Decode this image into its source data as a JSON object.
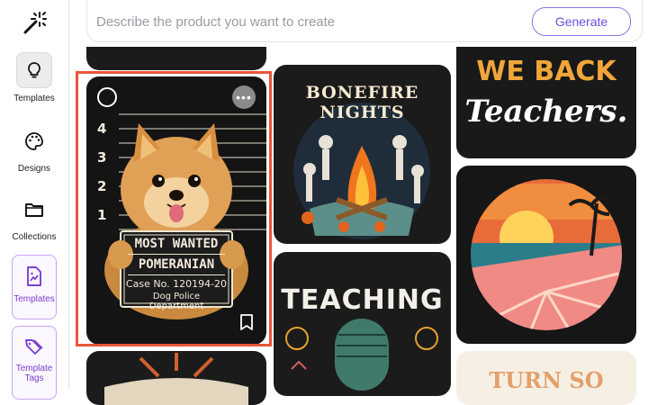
{
  "sidebar": {
    "items": [
      {
        "label": "Templates",
        "icon": "lightbulb-icon"
      },
      {
        "label": "Designs",
        "icon": "palette-icon"
      },
      {
        "label": "Collections",
        "icon": "folder-icon"
      },
      {
        "label": "Templates",
        "icon": "template-doc-icon"
      },
      {
        "label": "Template Tags",
        "icon": "tags-icon"
      }
    ]
  },
  "search": {
    "placeholder": "Describe the product you want to create",
    "generate_label": "Generate"
  },
  "gallery": {
    "poster": {
      "ruler": [
        "4",
        "3",
        "2",
        "1"
      ],
      "title1": "MOST WANTED",
      "title2": "POMERANIAN",
      "case": "Case No. 120194-20",
      "dept": "Dog Police Department"
    },
    "bonfire": {
      "title": "BONEFIRE NIGHTS"
    },
    "teachers": {
      "line1": "WE BACK",
      "line2": "Teachers."
    },
    "teaching": {
      "title": "TEACHING"
    },
    "bottom_partial": {
      "title": "TURN SO"
    }
  },
  "colors": {
    "accent": "#6a4fe0",
    "highlight": "#e8553a",
    "sidebar_active_border": "#c8a6f0"
  }
}
